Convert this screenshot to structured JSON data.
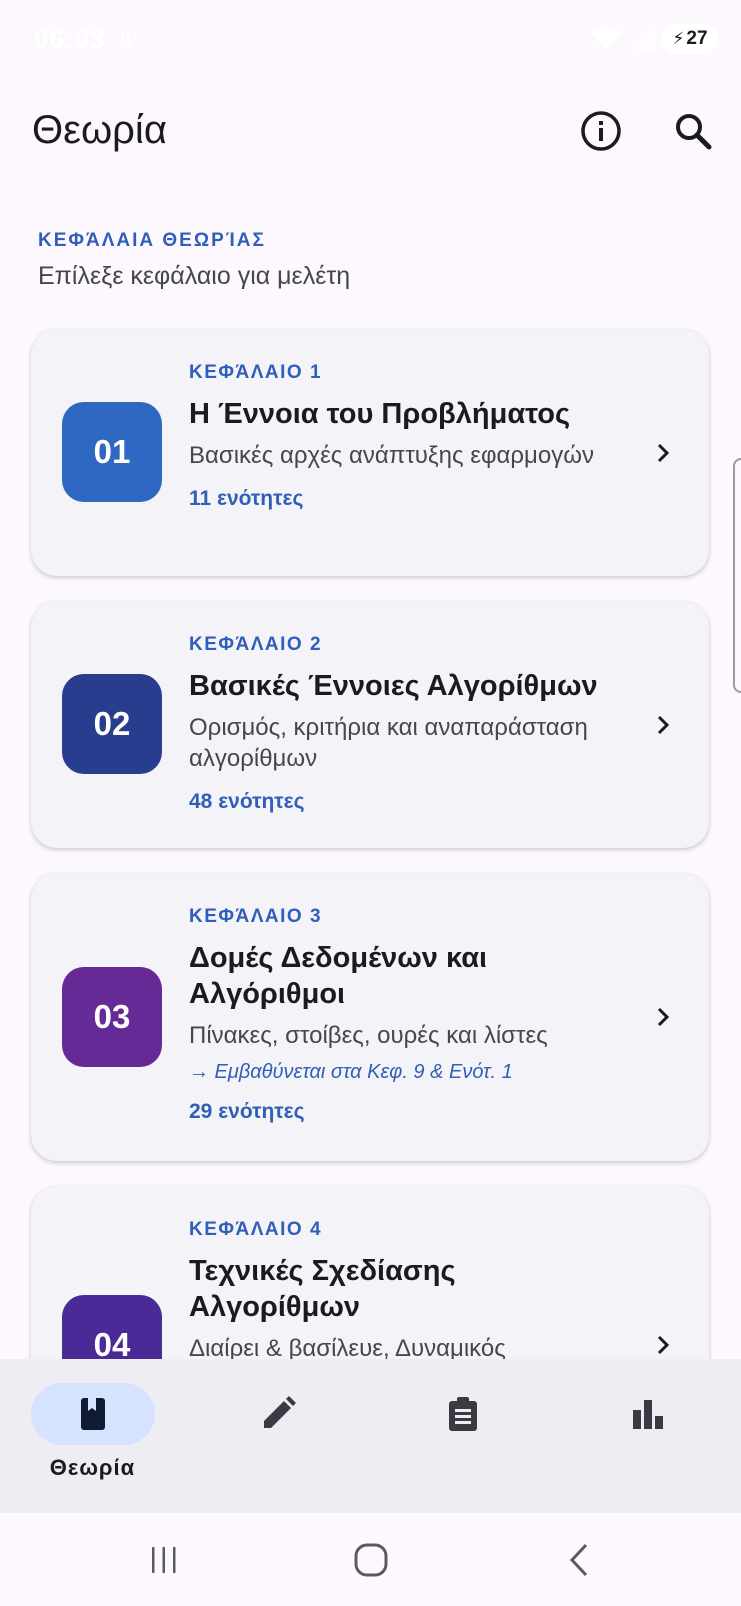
{
  "status_bar": {
    "time": "06:03",
    "usb_glyph": "ψ",
    "battery_level": "27",
    "icons": [
      "usb-icon",
      "wifi-icon",
      "signal-icon",
      "battery-charging-icon"
    ]
  },
  "app_bar": {
    "title": "Θεωρία",
    "actions": [
      "info-icon",
      "search-icon"
    ]
  },
  "section": {
    "overline": "ΚΕΦΆΛΑΙΑ ΘΕΩΡΊΑΣ",
    "subtitle": "Επίλεξε κεφάλαιο για μελέτη"
  },
  "chapters": [
    {
      "number": "01",
      "label": "ΚΕΦΆΛΑΙΟ 1",
      "title": "Η Έννοια του Προβλήματος",
      "description": "Βασικές αρχές ανάπτυξης εφαρμογών",
      "note": "",
      "count": "11 ενότητες",
      "color": "#2f68c3"
    },
    {
      "number": "02",
      "label": "ΚΕΦΆΛΑΙΟ 2",
      "title": "Βασικές Έννοιες Αλγορίθμων",
      "description": "Ορισμός, κριτήρια και αναπαράσταση αλγορίθμων",
      "note": "",
      "count": "48 ενότητες",
      "color": "#293d8e"
    },
    {
      "number": "03",
      "label": "ΚΕΦΆΛΑΙΟ 3",
      "title": "Δομές Δεδομένων και Αλγόριθμοι",
      "description": "Πίνακες, στοίβες, ουρές και λίστες",
      "note": "→ Εμβαθύνεται στα Κεφ. 9 & Ενότ. 1",
      "count": "29 ενότητες",
      "color": "#662a97"
    },
    {
      "number": "04",
      "label": "ΚΕΦΆΛΑΙΟ 4",
      "title": "Τεχνικές Σχεδίασης Αλγορίθμων",
      "description": "Διαίρει & βασίλευε, Δυναμικός",
      "note": "",
      "count": "",
      "color": "#4a2a96"
    }
  ],
  "bottom_nav": {
    "items": [
      {
        "label": "Θεωρία",
        "icon": "book-icon",
        "active": true
      },
      {
        "label": "",
        "icon": "pencil-icon",
        "active": false
      },
      {
        "label": "",
        "icon": "clipboard-icon",
        "active": false
      },
      {
        "label": "",
        "icon": "bar-chart-icon",
        "active": false
      }
    ],
    "active_color": "#d6e3ff"
  },
  "system_nav": {
    "buttons": [
      "recents-icon",
      "home-icon",
      "back-icon"
    ]
  },
  "colors": {
    "accent": "#2f5fb8",
    "background": "#fdf8fd",
    "card": "#f4f3f8"
  }
}
